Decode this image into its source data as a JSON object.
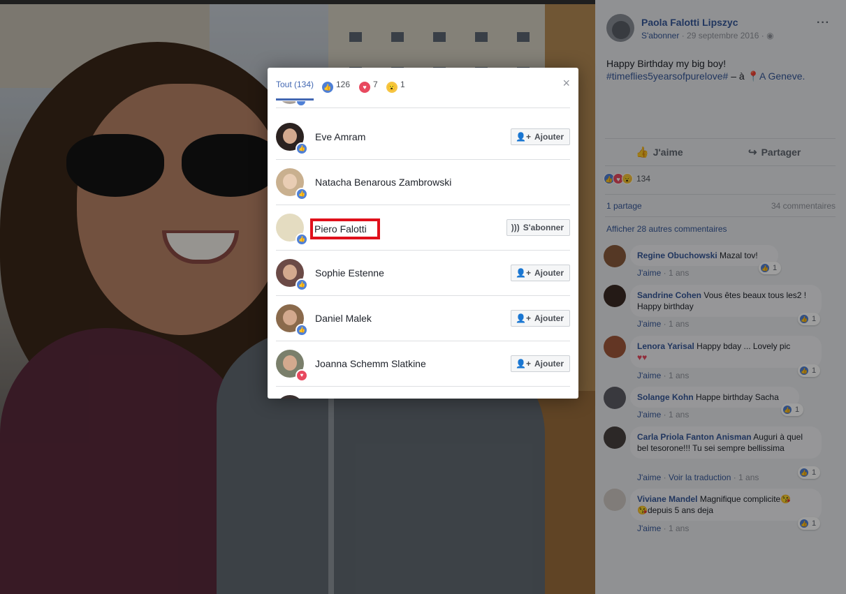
{
  "modal": {
    "tabs": [
      {
        "label": "Tout (134)"
      },
      {
        "count": "126",
        "icon": "like-icon"
      },
      {
        "count": "7",
        "icon": "love-icon"
      },
      {
        "count": "1",
        "icon": "wow-icon"
      }
    ],
    "close_label": "×",
    "people": [
      {
        "name": "Eve Amram",
        "reaction": "like",
        "button": "Ajouter",
        "button_icon": "add-friend-icon"
      },
      {
        "name": "Natacha Benarous Zambrowski",
        "reaction": "like",
        "button": "",
        "button_icon": ""
      },
      {
        "name": "Piero Falotti",
        "reaction": "like",
        "button": "S'abonner",
        "button_icon": "rss-icon",
        "highlighted": true
      },
      {
        "name": "Sophie Estenne",
        "reaction": "like",
        "button": "Ajouter",
        "button_icon": "add-friend-icon"
      },
      {
        "name": "Daniel Malek",
        "reaction": "like",
        "button": "Ajouter",
        "button_icon": "add-friend-icon"
      },
      {
        "name": "Joanna Schemm Slatkine",
        "reaction": "love",
        "button": "Ajouter",
        "button_icon": "add-friend-icon"
      }
    ]
  },
  "post": {
    "author": "Paola Falotti Lipszyc",
    "follow_label": "S'abonner",
    "date": "29 septembre 2016",
    "more_label": "···",
    "text": "Happy Birthday my big boy!",
    "hashtag": "#timeflies5yearsofpurelove#",
    "place_sep": " – à ",
    "place": "A Geneve."
  },
  "actions": {
    "like": "J'aime",
    "share": "Partager"
  },
  "reactions": {
    "count": "134"
  },
  "stats": {
    "shares": "1 partage",
    "comments": "34 commentaires"
  },
  "more_comments": "Afficher 28 autres commentaires",
  "comments": [
    {
      "name": "Regine Obuchowski",
      "text": "Mazal tov!",
      "meta_like": "J'aime",
      "time": "1 ans",
      "likes": "1"
    },
    {
      "name": "Sandrine Cohen",
      "text": "Vous êtes beaux tous les2 ! Happy birthday",
      "meta_like": "J'aime",
      "time": "1 ans",
      "likes": "1"
    },
    {
      "name": "Lenora Yarisal",
      "text": "Happy bday ... Lovely pic",
      "meta_like": "J'aime",
      "time": "1 ans",
      "likes": "1"
    },
    {
      "name": "Solange Kohn",
      "text": "Happe birthday Sacha",
      "meta_like": "J'aime",
      "time": "1 ans",
      "likes": "1"
    },
    {
      "name": "Carla Priola Fanton Anisman",
      "text": "Auguri à quel bel tesorone!!! Tu sei sempre bellissima",
      "meta_like": "J'aime",
      "translate": "Voir la traduction",
      "time": "1 ans",
      "likes": "1"
    },
    {
      "name": "Viviane Mandel",
      "text": "Magnifique complicite",
      "text2": "depuis 5 ans deja",
      "meta_like": "J'aime",
      "time": "1 ans",
      "likes": "1"
    }
  ],
  "colors": {
    "link": "#365899",
    "like": "#4f80d6",
    "love": "#e8495f",
    "wow": "#f6c543",
    "highlight": "#e0101b"
  }
}
